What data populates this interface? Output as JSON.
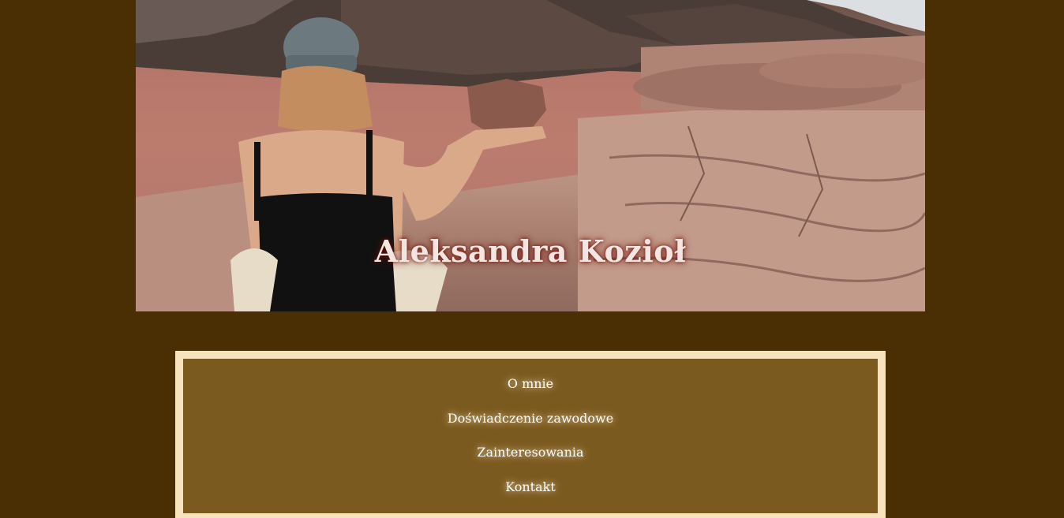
{
  "hero": {
    "title": "Aleksandra Kozioł",
    "image_alt": "woman-desert-photo"
  },
  "nav": {
    "items": [
      {
        "label": "O mnie"
      },
      {
        "label": "Doświadczenie zawodowe"
      },
      {
        "label": "Zainteresowania"
      },
      {
        "label": "Kontakt"
      }
    ]
  },
  "colors": {
    "page_background": "#4a2e04",
    "nav_border": "#f7e4bf",
    "nav_background": "#7b5a1f",
    "title_text": "#f3e6e2"
  }
}
